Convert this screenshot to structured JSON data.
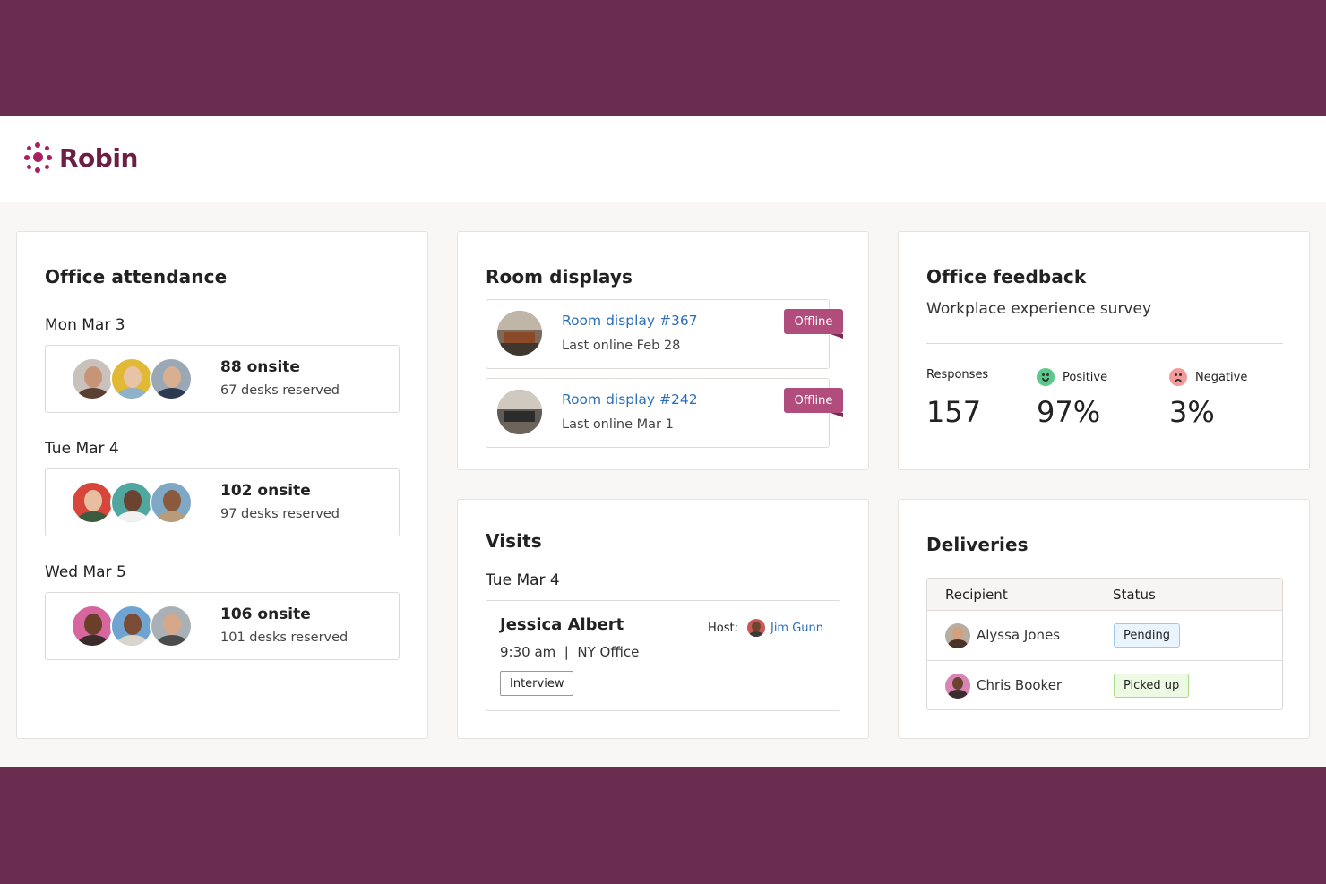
{
  "app": {
    "name": "Robin"
  },
  "attendance": {
    "title": "Office attendance",
    "days": [
      {
        "label": "Mon Mar 3",
        "onsite": "88 onsite",
        "desks": "67 desks reserved"
      },
      {
        "label": "Tue Mar 4",
        "onsite": "102 onsite",
        "desks": "97 desks reserved"
      },
      {
        "label": "Wed Mar 5",
        "onsite": "106 onsite",
        "desks": "101 desks reserved"
      }
    ]
  },
  "room_displays": {
    "title": "Room displays",
    "items": [
      {
        "name": "Room display #367",
        "last_online": "Last online Feb 28",
        "status": "Offline"
      },
      {
        "name": "Room display #242",
        "last_online": "Last online Mar 1",
        "status": "Offline"
      }
    ]
  },
  "feedback": {
    "title": "Office feedback",
    "subtitle": "Workplace experience survey",
    "stats": [
      {
        "label": "Responses",
        "value": "157"
      },
      {
        "label": "Positive",
        "value": "97%"
      },
      {
        "label": "Negative",
        "value": "3%"
      }
    ]
  },
  "visits": {
    "title": "Visits",
    "date": "Tue Mar 4",
    "visitor": "Jessica Albert",
    "time_location": "9:30 am  |  NY Office",
    "tag": "Interview",
    "host_label": "Host:",
    "host_name": "Jim Gunn"
  },
  "deliveries": {
    "title": "Deliveries",
    "columns": [
      "Recipient",
      "Status"
    ],
    "rows": [
      {
        "recipient": "Alyssa Jones",
        "status": "Pending"
      },
      {
        "recipient": "Chris Booker",
        "status": "Picked up"
      }
    ]
  },
  "colors": {
    "brand": "#6b2d4f",
    "brand_accent": "#a8205f",
    "offline_badge": "#b04d7d",
    "link": "#2a6fb8",
    "pending_bg": "#e9f4fc",
    "picked_bg": "#eef9e4"
  },
  "icons": [
    "robin-logo-icon",
    "smile-icon",
    "frown-icon"
  ]
}
